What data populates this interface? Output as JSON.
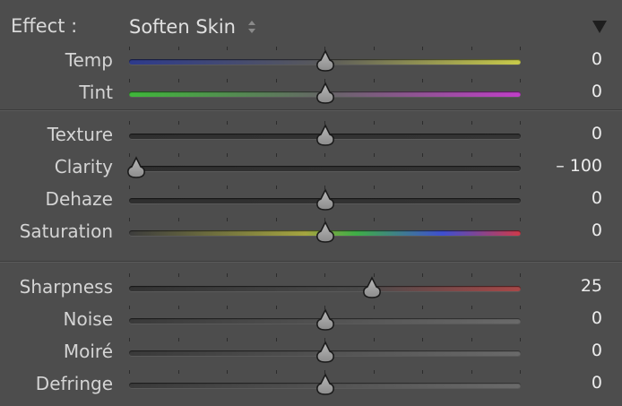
{
  "effect": {
    "label": "Effect :",
    "value": "Soften Skin"
  },
  "groups": [
    [
      {
        "label": "Temp",
        "value": "0",
        "position": 0.5,
        "track": "temp"
      },
      {
        "label": "Tint",
        "value": "0",
        "position": 0.5,
        "track": "tint"
      }
    ],
    [
      {
        "label": "Texture",
        "value": "0",
        "position": 0.5,
        "track": "plain"
      },
      {
        "label": "Clarity",
        "value": "– 100",
        "position": 0.0,
        "track": "plain"
      },
      {
        "label": "Dehaze",
        "value": "0",
        "position": 0.5,
        "track": "plain"
      },
      {
        "label": "Saturation",
        "value": "0",
        "position": 0.5,
        "track": "saturation"
      }
    ],
    [
      {
        "label": "Sharpness",
        "value": "25",
        "position": 0.625,
        "track": "sharpness"
      },
      {
        "label": "Noise",
        "value": "0",
        "position": 0.5,
        "track": "light"
      },
      {
        "label": "Moiré",
        "value": "0",
        "position": 0.5,
        "track": "light"
      },
      {
        "label": "Defringe",
        "value": "0",
        "position": 0.5,
        "track": "light"
      }
    ]
  ],
  "colors": {
    "background": "#4d4d4d",
    "temp": [
      "#2d3a8c",
      "#5a5a5a",
      "#c9cb4a"
    ],
    "tint": [
      "#3fb83a",
      "#666666",
      "#c03fc8"
    ],
    "plain": [
      "#2f2f2f",
      "#343434"
    ],
    "light": [
      "#3a3a3a",
      "#6a6a6a"
    ],
    "saturation": [
      "#3d3d3d",
      "#a5a540",
      "#3fae47",
      "#3f4fd0",
      "#d03a4a"
    ],
    "sharpness": [
      "#333333",
      "#4a4a4a",
      "#a84848"
    ]
  },
  "icons": {
    "effect_select": "updown-arrows-icon",
    "panel_toggle": "disclosure-triangle-icon",
    "slider_thumb": "slider-thumb-icon"
  }
}
